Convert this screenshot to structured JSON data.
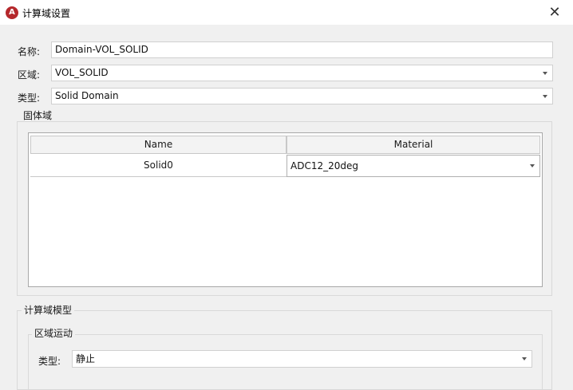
{
  "window": {
    "title": "计算域设置",
    "icon": "app-logo-icon",
    "close": "✕"
  },
  "form": {
    "name_label": "名称:",
    "name_value": "Domain-VOL_SOLID",
    "region_label": "区域:",
    "region_value": "VOL_SOLID",
    "type_label": "类型:",
    "type_value": "Solid Domain"
  },
  "solid_group": {
    "title": "固体域",
    "columns": [
      "Name",
      "Material"
    ],
    "rows": [
      {
        "name": "Solid0",
        "material": "ADC12_20deg"
      }
    ]
  },
  "model_group": {
    "title": "计算域模型",
    "motion_group": {
      "title": "区域运动",
      "type_label": "类型:",
      "type_value": "静止"
    }
  }
}
